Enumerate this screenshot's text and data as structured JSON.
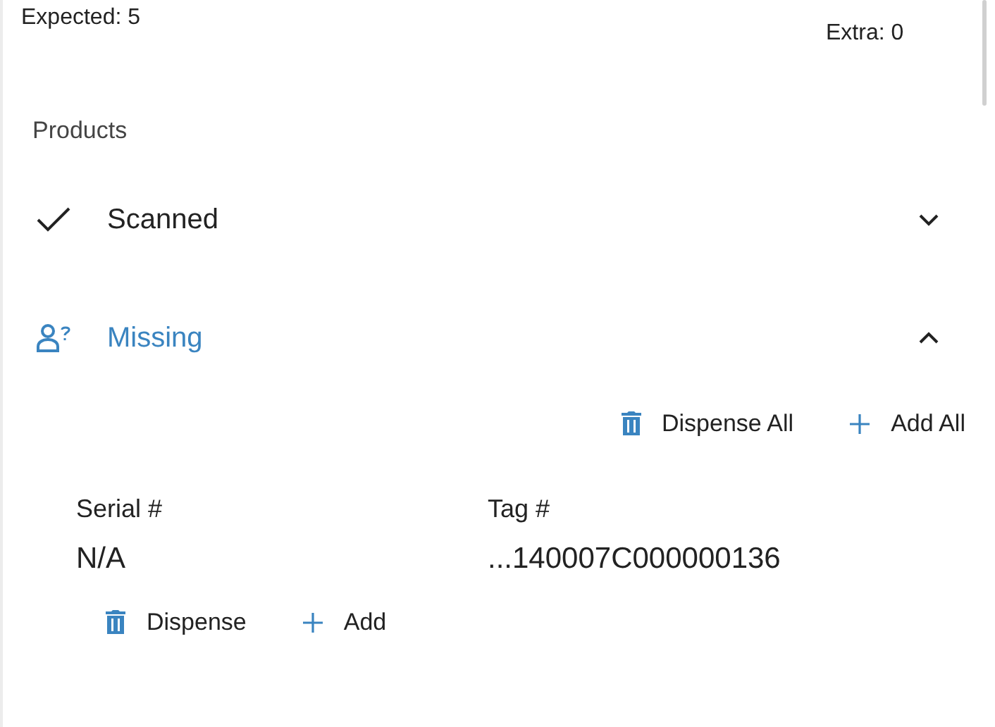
{
  "summary": {
    "expected": "Expected: 5",
    "extra": "Extra: 0"
  },
  "products_label": "Products",
  "sections": [
    {
      "kind": "scanned",
      "label": "Scanned",
      "expanded": false,
      "highlighted": false
    },
    {
      "kind": "missing",
      "label": "Missing",
      "expanded": true,
      "highlighted": true,
      "actions": [
        "Dispense All",
        "Add All"
      ],
      "items": [
        {
          "serial_label": "Serial #",
          "serial": "N/A",
          "tag_label": "Tag #",
          "tag": "...140007C000000136",
          "actions": [
            "Dispense",
            "Add"
          ]
        }
      ]
    }
  ]
}
